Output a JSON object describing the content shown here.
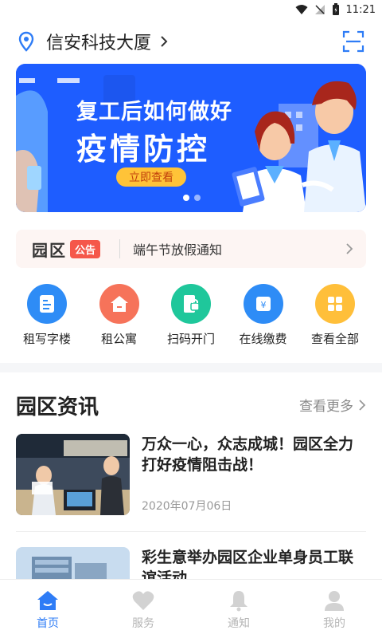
{
  "status_bar": {
    "time": "11:21"
  },
  "header": {
    "location": "信安科技大厦"
  },
  "banner": {
    "line1": "复工后如何做好",
    "line2": "疫情防控",
    "button": "立即查看"
  },
  "notice": {
    "logo": "园区",
    "tag": "公告",
    "text": "端午节放假通知"
  },
  "shortcuts": [
    {
      "label": "租写字楼",
      "icon": "office-building-icon",
      "color": "#2e8cf6"
    },
    {
      "label": "租公寓",
      "icon": "home-icon",
      "color": "#f6735a"
    },
    {
      "label": "扫码开门",
      "icon": "door-lock-icon",
      "color": "#1fc79b"
    },
    {
      "label": "在线缴费",
      "icon": "payment-icon",
      "color": "#2e8cf6"
    },
    {
      "label": "查看全部",
      "icon": "grid-icon",
      "color": "#ffbf3a"
    }
  ],
  "news_section": {
    "title": "园区资讯",
    "more": "查看更多"
  },
  "news": [
    {
      "title": "万众一心，众志成城！园区全力打好疫情阻击战！",
      "date": "2020年07月06日"
    },
    {
      "title": "彩生意举办园区企业单身员工联谊活动",
      "date": ""
    }
  ],
  "tabs": [
    {
      "label": "首页",
      "icon": "home-tab-icon",
      "active": true
    },
    {
      "label": "服务",
      "icon": "heart-tab-icon",
      "active": false
    },
    {
      "label": "通知",
      "icon": "bell-tab-icon",
      "active": false
    },
    {
      "label": "我的",
      "icon": "user-tab-icon",
      "active": false
    }
  ],
  "colors": {
    "accent": "#2e7cf6",
    "banner_bg": "#1e5dff",
    "tag_red": "#f5574a"
  }
}
